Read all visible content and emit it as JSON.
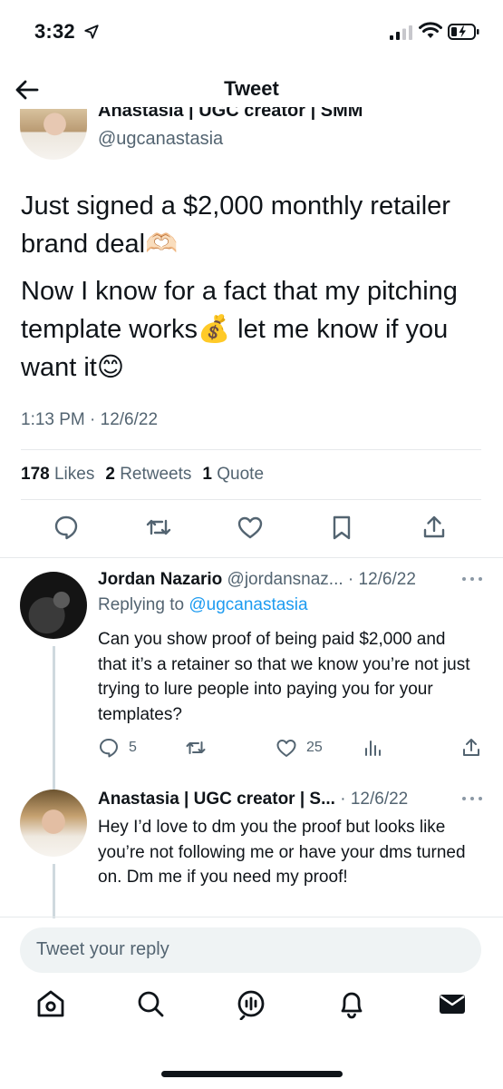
{
  "status_bar": {
    "time": "3:32",
    "icons": [
      "location-arrow-icon",
      "signal-icon",
      "wifi-icon",
      "battery-charging-icon"
    ]
  },
  "header": {
    "title": "Tweet",
    "back_icon": "back-arrow-icon"
  },
  "main_tweet": {
    "author_name": "Anastasia | UGC creator | SMM",
    "author_handle": "@ugcanastasia",
    "paragraphs": [
      "Just signed a $2,000 monthly retailer brand deal🫶🏻",
      "Now I know for a fact that my pitching template works💰 let me know if you want it😊"
    ],
    "timestamp": "1:13 PM · 12/6/22",
    "stats": {
      "likes_count": "178",
      "likes_label": "Likes",
      "retweets_count": "2",
      "retweets_label": "Retweets",
      "quotes_count": "1",
      "quotes_label": "Quote"
    },
    "actions": [
      "reply-icon",
      "retweet-icon",
      "like-icon",
      "bookmark-icon",
      "share-icon"
    ]
  },
  "replies": [
    {
      "author_name": "Jordan Nazario",
      "author_handle": "@jordansnaz...",
      "date": "12/6/22",
      "replying_to_prefix": "Replying to",
      "replying_to_handle": "@ugcanastasia",
      "text": "Can you show proof of being paid $2,000 and that it’s a retainer so that we know you’re not just trying to lure people into paying you for your templates?",
      "reply_count": "5",
      "like_count": "25"
    },
    {
      "author_name": "Anastasia | UGC creator | S...",
      "date": "12/6/22",
      "text": "Hey I’d love to dm you the proof but looks like you’re not following me or have your dms turned on. Dm me if you need my proof!"
    }
  ],
  "compose": {
    "placeholder": "Tweet your reply"
  },
  "tab_bar": {
    "tabs": [
      "home-icon",
      "search-icon",
      "spaces-icon",
      "notifications-icon",
      "messages-icon"
    ]
  },
  "colors": {
    "text": "#0f1419",
    "secondary": "#536471",
    "link": "#1d9bf0",
    "divider": "#e6e9eb",
    "compose_bg": "#eff3f4"
  }
}
